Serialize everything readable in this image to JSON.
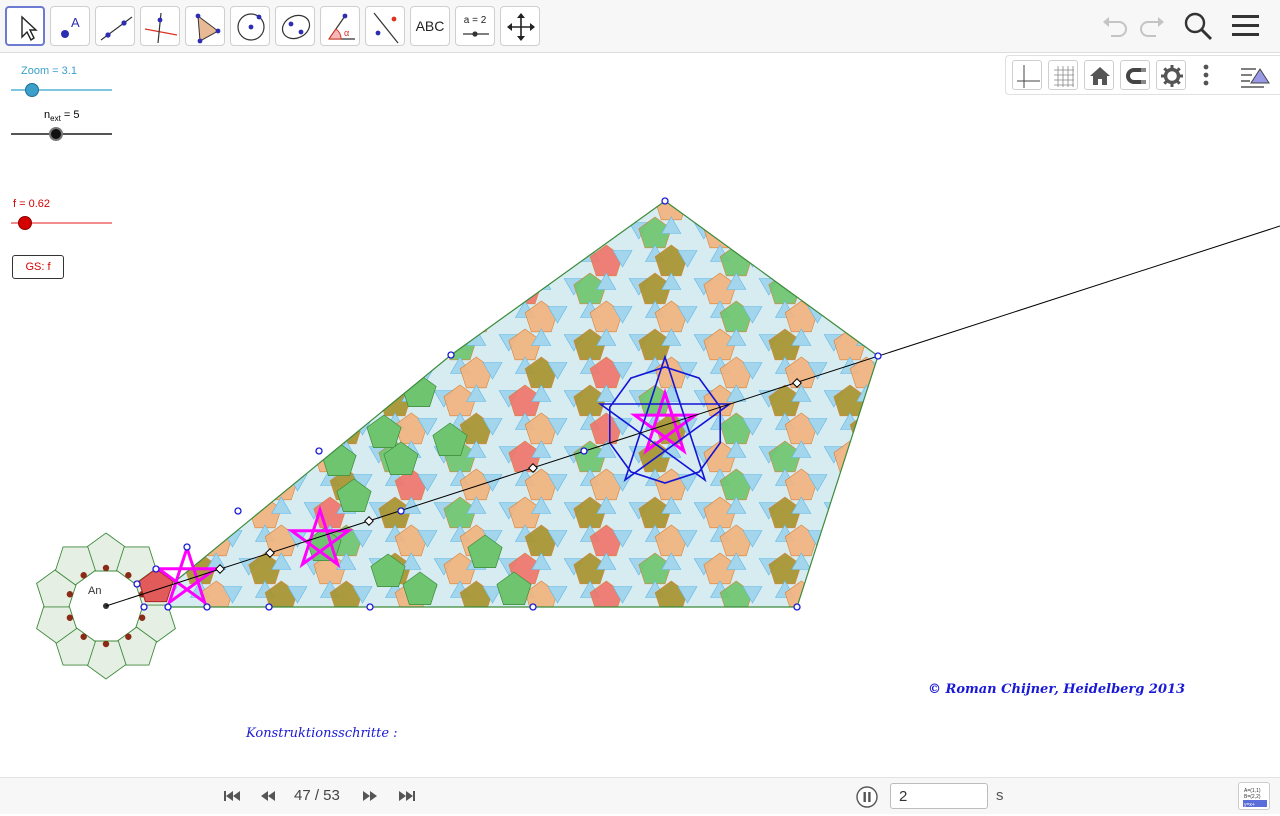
{
  "toolbar": {
    "tools": [
      {
        "id": "move",
        "icon": "arrow-pointer-icon"
      },
      {
        "id": "point",
        "icon": "point-icon",
        "label": "A"
      },
      {
        "id": "line",
        "icon": "line-icon"
      },
      {
        "id": "perpendicular",
        "icon": "perpendicular-line-icon"
      },
      {
        "id": "polygon",
        "icon": "polygon-icon"
      },
      {
        "id": "circle",
        "icon": "circle-center-icon"
      },
      {
        "id": "ellipse",
        "icon": "ellipse-icon"
      },
      {
        "id": "angle",
        "icon": "angle-icon",
        "label": "α"
      },
      {
        "id": "reflect",
        "icon": "reflect-icon"
      },
      {
        "id": "text",
        "icon": "text-icon",
        "label": "ABC"
      },
      {
        "id": "slider",
        "icon": "slider-icon",
        "label": "a = 2"
      },
      {
        "id": "move-view",
        "icon": "move-graphics-view-icon"
      }
    ],
    "right_icons": [
      "undo-icon",
      "redo-icon",
      "search-icon",
      "menu-icon"
    ]
  },
  "stylebar": {
    "buttons": [
      "axes-icon",
      "grid-icon",
      "home-icon",
      "point-capture-icon",
      "gear-icon",
      "more-vertical-icon",
      "style-bar-toggle-icon"
    ]
  },
  "sliders": {
    "zoom": {
      "label": "Zoom = 3.1",
      "value": 3.1,
      "color": "#3c9fc9"
    },
    "next": {
      "label_base": "n",
      "label_sub": "ext",
      "label_value": " = 5",
      "value": 5,
      "color": "#000000"
    },
    "f": {
      "label": "f = 0.62",
      "value": 0.62,
      "color": "#d50000"
    }
  },
  "gs_button": {
    "label": "GS:  f"
  },
  "canvas": {
    "point_label": "An",
    "colors": {
      "hexagon_fill": "#d7ecf1",
      "triangle_fill": "#a3d6ec",
      "pentagon_orange": "#f2b47f",
      "pentagon_green": "#6fc56f",
      "pentagon_pink": "#f4a7b9",
      "pentagon_red": "#f0766c",
      "pentagon_olive": "#a8942f",
      "star_magenta": "#ff00ff",
      "star_blue": "#1414d6",
      "outline_green": "#3b8a3b"
    }
  },
  "texts": {
    "copyright": "© Roman Chijner,  Heidelberg 2013",
    "konstr": "Konstruktionsschritte :"
  },
  "navigation": {
    "step_counter": "47 / 53",
    "interval_value": "2",
    "interval_unit": "s",
    "buttons": [
      "skip-to-start-icon",
      "step-back-icon",
      "step-forward-icon",
      "skip-to-end-icon",
      "pause-icon"
    ]
  }
}
